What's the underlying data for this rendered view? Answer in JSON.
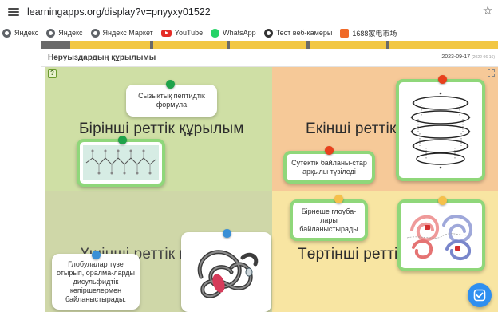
{
  "browser": {
    "url": "learningapps.org/display?v=pnyyxy01522",
    "bookmarks": [
      {
        "label": "Яндекс",
        "icon": "yandex-globe-icon"
      },
      {
        "label": "Яндекс",
        "icon": "yandex-globe-icon"
      },
      {
        "label": "Яндекс Маркет",
        "icon": "yandex-globe-icon"
      },
      {
        "label": "YouTube",
        "icon": "youtube-icon"
      },
      {
        "label": "WhatsApp",
        "icon": "whatsapp-icon"
      },
      {
        "label": "Тест веб-камеры",
        "icon": "webcam-icon"
      },
      {
        "label": "1688家电市场",
        "icon": "shop-icon"
      }
    ]
  },
  "app": {
    "title": "Нәруыздардың құрылымы",
    "date": "2023-09-17",
    "date_small": "(2022-06-16)"
  },
  "quadrants": [
    {
      "title": "Бірінші реттік құрылым",
      "color": "#cfdfa5"
    },
    {
      "title": "Екінші реттік",
      "color": "#f6c998"
    },
    {
      "title": "Үшінші реттік к",
      "color": "#cfd7a8"
    },
    {
      "title": "Төртінші ретті",
      "color": "#f8e5a2"
    }
  ],
  "cards": {
    "peptide_formula": "Сызықтық пептидтік формула",
    "hydrogen_bonds": "Сутектік байланы-стар арқылы түзіледі",
    "globules": "Бірнеше глоуба-лары байланыстырады",
    "disulfide": "Глобулалар түзе отырып, оралма-ларды дисульфидтік көпіршелермен байланыстырады."
  },
  "colors": {
    "pin_green": "#1fa34a",
    "pin_red": "#e8401c",
    "pin_yellow": "#f5c04a",
    "pin_blue": "#3a8fd6",
    "card_border": "#8fd77a",
    "check_button": "#2f8ff0"
  },
  "controls": {
    "help_icon": "question-mark-icon",
    "fullscreen_icon": "fullscreen-icon",
    "check_icon": "check-icon"
  }
}
